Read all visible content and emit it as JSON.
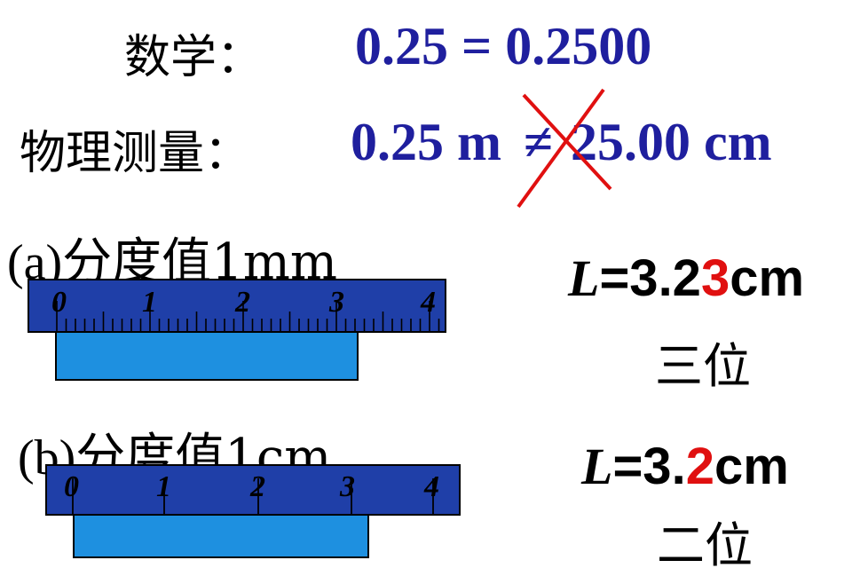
{
  "math": {
    "label": "数学：",
    "equation": "0.25 = 0.2500"
  },
  "physics": {
    "label": "物理测量：",
    "lhs": "0.25 m",
    "neq": "≠",
    "rhs": "25.00 cm"
  },
  "ruler_a": {
    "label_prefix": "(a)",
    "label_text": "分度值1mm",
    "ticks": [
      "0",
      "1",
      "2",
      "3",
      "4"
    ],
    "result_var": "L",
    "result_eq": "=3.2",
    "result_doubtful": "3",
    "result_unit": "cm",
    "digits": "三位"
  },
  "ruler_b": {
    "label_prefix": "(b)",
    "label_text": "分度值1cm",
    "ticks": [
      "0",
      "1",
      "2",
      "3",
      "4"
    ],
    "result_var": "L",
    "result_eq": "=3.",
    "result_doubtful": "2",
    "result_unit": "cm",
    "digits": "二位"
  },
  "colors": {
    "ruler": "#1f3fa8",
    "object": "#1e90e0",
    "math_text": "#1f1f9e",
    "highlight": "#e01010"
  }
}
